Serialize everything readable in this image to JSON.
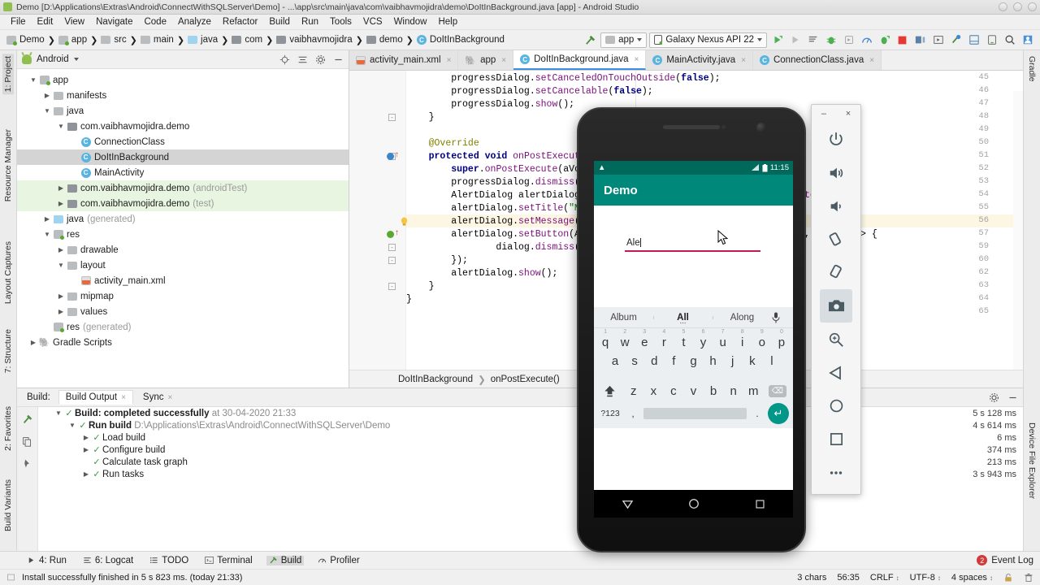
{
  "window": {
    "title": "Demo [D:\\Applications\\Extras\\Android\\ConnectWithSQLServer\\Demo] - ...\\app\\src\\main\\java\\com\\vaibhavmojidra\\demo\\DoItInBackground.java [app] - Android Studio"
  },
  "menu": [
    "File",
    "Edit",
    "View",
    "Navigate",
    "Code",
    "Analyze",
    "Refactor",
    "Build",
    "Run",
    "Tools",
    "VCS",
    "Window",
    "Help"
  ],
  "breadcrumb": [
    {
      "label": "Demo",
      "icon": "module-icon"
    },
    {
      "label": "app",
      "icon": "module-icon"
    },
    {
      "label": "src",
      "icon": "folder-icon"
    },
    {
      "label": "main",
      "icon": "folder-icon"
    },
    {
      "label": "java",
      "icon": "folder-source-icon"
    },
    {
      "label": "com",
      "icon": "folder-package-icon"
    },
    {
      "label": "vaibhavmojidra",
      "icon": "folder-package-icon"
    },
    {
      "label": "demo",
      "icon": "folder-package-icon"
    },
    {
      "label": "DoItInBackground",
      "icon": "class-icon"
    }
  ],
  "toolbar": {
    "run_config": "app",
    "device": "Galaxy Nexus API 22"
  },
  "left_rail": [
    "1: Project",
    "Resource Manager",
    "Layout Captures",
    "7: Structure",
    "2: Favorites",
    "Build Variants"
  ],
  "right_rail": [
    "Gradle",
    "Device File Explorer"
  ],
  "project": {
    "title": "Android",
    "tree": [
      {
        "depth": 0,
        "arrow": "d",
        "icon": "module-icon",
        "label": "app",
        "suffix": "",
        "state": ""
      },
      {
        "depth": 1,
        "arrow": "r",
        "icon": "folder-icon",
        "label": "manifests",
        "suffix": "",
        "state": ""
      },
      {
        "depth": 1,
        "arrow": "d",
        "icon": "folder-icon",
        "label": "java",
        "suffix": "",
        "state": ""
      },
      {
        "depth": 2,
        "arrow": "d",
        "icon": "package-icon",
        "label": "com.vaibhavmojidra.demo",
        "suffix": "",
        "state": ""
      },
      {
        "depth": 3,
        "arrow": "",
        "icon": "class-icon",
        "label": "ConnectionClass",
        "suffix": "",
        "state": ""
      },
      {
        "depth": 3,
        "arrow": "",
        "icon": "class-icon",
        "label": "DoItInBackground",
        "suffix": "",
        "state": "selected"
      },
      {
        "depth": 3,
        "arrow": "",
        "icon": "class-icon",
        "label": "MainActivity",
        "suffix": "",
        "state": ""
      },
      {
        "depth": 2,
        "arrow": "r",
        "icon": "package-icon",
        "label": "com.vaibhavmojidra.demo",
        "suffix": "(androidTest)",
        "state": "green"
      },
      {
        "depth": 2,
        "arrow": "r",
        "icon": "package-icon",
        "label": "com.vaibhavmojidra.demo",
        "suffix": "(test)",
        "state": "green"
      },
      {
        "depth": 1,
        "arrow": "r",
        "icon": "folder-source-icon",
        "label": "java",
        "suffix": "(generated)",
        "state": ""
      },
      {
        "depth": 1,
        "arrow": "d",
        "icon": "res-icon",
        "label": "res",
        "suffix": "",
        "state": ""
      },
      {
        "depth": 2,
        "arrow": "r",
        "icon": "folder-icon",
        "label": "drawable",
        "suffix": "",
        "state": ""
      },
      {
        "depth": 2,
        "arrow": "d",
        "icon": "folder-icon",
        "label": "layout",
        "suffix": "",
        "state": ""
      },
      {
        "depth": 3,
        "arrow": "",
        "icon": "xml-icon",
        "label": "activity_main.xml",
        "suffix": "",
        "state": ""
      },
      {
        "depth": 2,
        "arrow": "r",
        "icon": "folder-icon",
        "label": "mipmap",
        "suffix": "",
        "state": ""
      },
      {
        "depth": 2,
        "arrow": "r",
        "icon": "folder-icon",
        "label": "values",
        "suffix": "",
        "state": ""
      },
      {
        "depth": 1,
        "arrow": "",
        "icon": "res-icon",
        "label": "res",
        "suffix": "(generated)",
        "state": ""
      },
      {
        "depth": 0,
        "arrow": "r",
        "icon": "gradle-icon",
        "label": "Gradle Scripts",
        "suffix": "",
        "state": ""
      }
    ]
  },
  "editor": {
    "tabs": [
      {
        "label": "activity_main.xml",
        "icon": "xml-icon",
        "active": false
      },
      {
        "label": "app",
        "icon": "gradle-icon",
        "active": false
      },
      {
        "label": "DoItInBackground.java",
        "icon": "class-icon",
        "active": true
      },
      {
        "label": "MainActivity.java",
        "icon": "class-icon",
        "active": false
      },
      {
        "label": "ConnectionClass.java",
        "icon": "class-icon",
        "active": false
      }
    ],
    "lines": [
      {
        "num": "45",
        "indent": 8,
        "text": "progressDialog.setCanceledOnTouchOutside(false);"
      },
      {
        "num": "46",
        "indent": 8,
        "text": "progressDialog.setCancelable(false);"
      },
      {
        "num": "47",
        "indent": 8,
        "text": "progressDialog.show();"
      },
      {
        "num": "48",
        "indent": 4,
        "text": "}"
      },
      {
        "num": "49",
        "indent": 0,
        "text": ""
      },
      {
        "num": "50",
        "indent": 4,
        "text": "@Override"
      },
      {
        "num": "51",
        "indent": 4,
        "text": "protected void onPostExecute(Void aVoid) {"
      },
      {
        "num": "52",
        "indent": 8,
        "text": "super.onPostExecute(aVoid);"
      },
      {
        "num": "53",
        "indent": 8,
        "text": "progressDialog.dismiss();"
      },
      {
        "num": "54",
        "indent": 8,
        "text": "AlertDialog alertDialog = new AlertDialog.Builder(context).create();"
      },
      {
        "num": "55",
        "indent": 8,
        "text": "alertDialog.setTitle(\"Message\");"
      },
      {
        "num": "56",
        "indent": 8,
        "text": "alertDialog.setMessage(Result);"
      },
      {
        "num": "57",
        "indent": 8,
        "text": "alertDialog.setButton(AlertDialog.BUTTON_NEUTRAL, \"OK\", (dialog, which) -> {"
      },
      {
        "num": "59",
        "indent": 16,
        "text": "dialog.dismiss();"
      },
      {
        "num": "60",
        "indent": 8,
        "text": "});"
      },
      {
        "num": "62",
        "indent": 8,
        "text": "alertDialog.show();"
      },
      {
        "num": "63",
        "indent": 4,
        "text": "}"
      },
      {
        "num": "64",
        "indent": 0,
        "text": "}"
      },
      {
        "num": "65",
        "indent": 0,
        "text": ""
      }
    ],
    "breadcrumb": [
      "DoItInBackground",
      "onPostExecute()"
    ],
    "lambda_fragment": "(dialog, which) -> {"
  },
  "build_panel": {
    "label": "Build:",
    "tabs": [
      {
        "label": "Build Output",
        "active": true
      },
      {
        "label": "Sync",
        "active": false
      }
    ],
    "rows": [
      {
        "depth": 0,
        "arrow": "d",
        "label": "Build: completed successfully",
        "detail": "at 30-04-2020 21:33",
        "bold": true,
        "time": "5 s 128 ms"
      },
      {
        "depth": 1,
        "arrow": "d",
        "label": "Run build",
        "detail": "D:\\Applications\\Extras\\Android\\ConnectWithSQLServer\\Demo",
        "bold": true,
        "time": "4 s 614 ms"
      },
      {
        "depth": 2,
        "arrow": "r",
        "label": "Load build",
        "detail": "",
        "bold": false,
        "time": "6 ms"
      },
      {
        "depth": 2,
        "arrow": "r",
        "label": "Configure build",
        "detail": "",
        "bold": false,
        "time": "374 ms"
      },
      {
        "depth": 2,
        "arrow": "",
        "label": "Calculate task graph",
        "detail": "",
        "bold": false,
        "time": "213 ms"
      },
      {
        "depth": 2,
        "arrow": "r",
        "label": "Run tasks",
        "detail": "",
        "bold": false,
        "time": "3 s 943 ms"
      }
    ]
  },
  "status": {
    "tools": [
      {
        "label": "4: Run",
        "icon": "run-icon",
        "active": false
      },
      {
        "label": "6: Logcat",
        "icon": "logcat-icon",
        "active": false
      },
      {
        "label": "TODO",
        "icon": "todo-icon",
        "active": false
      },
      {
        "label": "Terminal",
        "icon": "terminal-icon",
        "active": false
      },
      {
        "label": "Build",
        "icon": "build-icon",
        "active": true
      },
      {
        "label": "Profiler",
        "icon": "profiler-icon",
        "active": false
      }
    ],
    "event_log": "Event Log",
    "event_count": "2",
    "message": "Install successfully finished in 5 s 823 ms. (today 21:33)",
    "right": [
      "3 chars",
      "56:35",
      "CRLF",
      "UTF-8",
      "4 spaces"
    ]
  },
  "emulator": {
    "status_time": "11:15",
    "app_title": "Demo",
    "edit_value": "Ale",
    "suggestions": [
      "Album",
      "All",
      "Along"
    ],
    "keyboard": {
      "row1": [
        {
          "k": "q",
          "n": "1"
        },
        {
          "k": "w",
          "n": "2"
        },
        {
          "k": "e",
          "n": "3"
        },
        {
          "k": "r",
          "n": "4"
        },
        {
          "k": "t",
          "n": "5"
        },
        {
          "k": "y",
          "n": "6"
        },
        {
          "k": "u",
          "n": "7"
        },
        {
          "k": "i",
          "n": "8"
        },
        {
          "k": "o",
          "n": "9"
        },
        {
          "k": "p",
          "n": "0"
        }
      ],
      "row2": [
        "a",
        "s",
        "d",
        "f",
        "g",
        "h",
        "j",
        "k",
        "l"
      ],
      "row3": [
        "z",
        "x",
        "c",
        "v",
        "b",
        "n",
        "m"
      ],
      "sym_key": "?123",
      "comma": ",",
      "period": "."
    },
    "toolbar_buttons": [
      "power-icon",
      "volume-up-icon",
      "volume-down-icon",
      "rotate-left-icon",
      "rotate-right-icon",
      "screenshot-icon",
      "zoom-icon",
      "back-icon",
      "home-icon",
      "overview-icon",
      "more-icon"
    ],
    "minimize_label": "–",
    "close_label": "×"
  },
  "colors": {
    "accent": "#00897b",
    "status_bar": "#00695c",
    "underline": "#c2185b",
    "selection": "#3b74c4",
    "success": "#3c9a3c"
  }
}
